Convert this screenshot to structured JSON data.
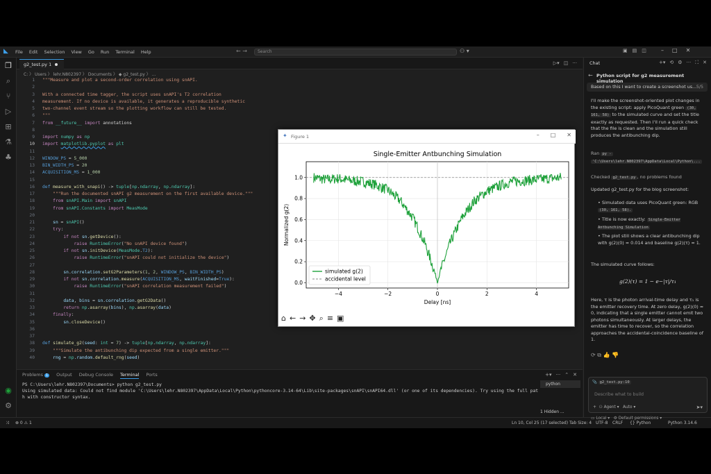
{
  "titlebar": {
    "menus": [
      "File",
      "Edit",
      "Selection",
      "View",
      "Go",
      "Run",
      "Terminal",
      "Help"
    ],
    "search_placeholder": "Search"
  },
  "editor": {
    "tab_label": "g2_test.py 1",
    "breadcrumb": "C: 〉 Users 〉 lehr.N802397 〉 Documents 〉 ◆ g2_test.py 〉 ...",
    "lines": [
      {
        "n": "1",
        "html": "<span class='s'>\"\"\"Measure and plot a second-order correlation using snAPI.</span>"
      },
      {
        "n": "2",
        "html": ""
      },
      {
        "n": "3",
        "html": "<span class='s'>With a connected time tagger, the script uses snAPI's T2 correlation</span>"
      },
      {
        "n": "4",
        "html": "<span class='s'>measurement. If no device is available, it generates a reproducible synthetic</span>"
      },
      {
        "n": "5",
        "html": "<span class='s'>two-channel event stream so the plotting workflow can still be tested.</span>"
      },
      {
        "n": "6",
        "html": "<span class='s'>\"\"\"</span>"
      },
      {
        "n": "7",
        "html": "<span class='k'>from</span> <span class='t'>__future__</span> <span class='k'>import</span> annotations"
      },
      {
        "n": "8",
        "html": ""
      },
      {
        "n": "9",
        "html": "<span class='k'>import</span> <span class='t'>numpy</span> <span class='k'>as</span> <span class='t'>np</span>"
      },
      {
        "n": "10",
        "html": "<span class='k'>import</span> <span class='t' style='text-decoration:underline wavy #3c9ee8'>matplotlib.pyplot</span> <span class='k'>as</span> <span class='t'>plt</span>"
      },
      {
        "n": "11",
        "html": ""
      },
      {
        "n": "12",
        "html": "<span class='d'>WINDOW_PS</span> = <span class='n'>5_000</span>"
      },
      {
        "n": "13",
        "html": "<span class='d'>BIN_WIDTH_PS</span> = <span class='n'>20</span>"
      },
      {
        "n": "14",
        "html": "<span class='d'>ACQUISITION_MS</span> = <span class='n'>1_000</span>"
      },
      {
        "n": "15",
        "html": ""
      },
      {
        "n": "16",
        "html": "<span class='d'>def</span> <span class='f'>measure_with_snapi</span>() -> <span class='t'>tuple</span>[<span class='t'>np</span>.<span class='t'>ndarray</span>, <span class='t'>np</span>.<span class='t'>ndarray</span>]:"
      },
      {
        "n": "17",
        "html": "    <span class='s'>\"\"\"Run the documented snAPI g2 measurement on the first available device.\"\"\"</span>"
      },
      {
        "n": "18",
        "html": "    <span class='k'>from</span> <span class='t'>snAPI.Main</span> <span class='k'>import</span> <span class='t'>snAPI</span>"
      },
      {
        "n": "19",
        "html": "    <span class='k'>from</span> <span class='t'>snAPI.Constants</span> <span class='k'>import</span> <span class='t'>MeasMode</span>"
      },
      {
        "n": "20",
        "html": ""
      },
      {
        "n": "21",
        "html": "    <span class='v'>sn</span> = <span class='t'>snAPI</span>()"
      },
      {
        "n": "22",
        "html": "    <span class='k'>try</span>:"
      },
      {
        "n": "23",
        "html": "        <span class='k'>if not</span> <span class='v'>sn</span>.<span class='f'>getDevice</span>():"
      },
      {
        "n": "24",
        "html": "            <span class='k'>raise</span> <span class='t'>RuntimeError</span>(<span class='s'>\"No snAPI device found\"</span>)"
      },
      {
        "n": "25",
        "html": "        <span class='k'>if not</span> <span class='v'>sn</span>.<span class='f'>initDevice</span>(<span class='t'>MeasMode</span>.<span class='d'>T2</span>):"
      },
      {
        "n": "26",
        "html": "            <span class='k'>raise</span> <span class='t'>RuntimeError</span>(<span class='s'>\"snAPI could not initialize the device\"</span>)"
      },
      {
        "n": "27",
        "html": ""
      },
      {
        "n": "28",
        "html": "        <span class='v'>sn</span>.<span class='v'>correlation</span>.<span class='f'>setG2Parameters</span>(<span class='n'>1</span>, <span class='n'>2</span>, <span class='d'>WINDOW_PS</span>, <span class='d'>BIN_WIDTH_PS</span>)"
      },
      {
        "n": "29",
        "html": "        <span class='k'>if not</span> <span class='v'>sn</span>.<span class='v'>correlation</span>.<span class='f'>measure</span>(<span class='d'>ACQUISITION_MS</span>, <span class='v'>waitFinished</span>=<span class='d'>True</span>):"
      },
      {
        "n": "30",
        "html": "            <span class='k'>raise</span> <span class='t'>RuntimeError</span>(<span class='s'>\"snAPI correlation measurement failed\"</span>)"
      },
      {
        "n": "31",
        "html": ""
      },
      {
        "n": "32",
        "html": "        <span class='v'>data</span>, <span class='v'>bins</span> = <span class='v'>sn</span>.<span class='v'>correlation</span>.<span class='f'>getG2Data</span>()"
      },
      {
        "n": "33",
        "html": "        <span class='k'>return</span> <span class='t'>np</span>.<span class='f'>asarray</span>(<span class='v'>bins</span>), <span class='t'>np</span>.<span class='f'>asarray</span>(<span class='v'>data</span>)"
      },
      {
        "n": "34",
        "html": "    <span class='k'>finally</span>:"
      },
      {
        "n": "35",
        "html": "        <span class='v'>sn</span>.<span class='f'>closeDevice</span>()"
      },
      {
        "n": "36",
        "html": ""
      },
      {
        "n": "37",
        "html": ""
      },
      {
        "n": "38",
        "html": "<span class='d'>def</span> <span class='f'>simulate_g2</span>(<span class='v'>seed</span>: <span class='t'>int</span> = <span class='n'>7</span>) -> <span class='t'>tuple</span>[<span class='t'>np</span>.<span class='t'>ndarray</span>, <span class='t'>np</span>.<span class='t'>ndarray</span>]:"
      },
      {
        "n": "39",
        "html": "    <span class='s'>\"\"\"Simulate the antibunching dip expected from a single emitter.\"\"\"</span>"
      },
      {
        "n": "40",
        "html": "    <span class='v'>rng</span> = <span class='t'>np</span>.<span class='v'>random</span>.<span class='f'>default_rng</span>(<span class='v'>seed</span>)"
      }
    ]
  },
  "panel": {
    "tabs": [
      "Problems",
      "Output",
      "Debug Console",
      "Terminal",
      "Ports"
    ],
    "problems_count": "1",
    "terminal_name": "python",
    "hidden": "1 Hidden ...",
    "terminal_lines": [
      "PS C:\\Users\\lehr.N802397\\Documents> python g2_test.py",
      "Using simulated data: Could not find module 'C:\\Users\\lehr.N802397\\AppData\\Local\\Python\\pythoncore-3.14-64\\Lib\\site-packages\\snAPI\\snAPI64.dll' (or one of its dependencies). Try using the full pat",
      "h with constructor syntax."
    ]
  },
  "status": {
    "errors": "⊗ 0 ⚠ 1",
    "position": "Ln 10, Col 25 (17 selected)",
    "tab": "Tab Size: 4",
    "enc": "UTF-8",
    "eol": "CRLF",
    "lang": "{} Python",
    "ver": "Python 3.14.6"
  },
  "chat": {
    "header": "Chat",
    "title": "Python script for g2 measurement simulation",
    "query": "Based on this I want to create a screenshot us...",
    "query_count": "5/5",
    "p1a": "I'll make the screenshot-oriented plot changes in the existing script: apply PicoQuant green",
    "p1chip": "(30, 161, 58)",
    "p1b": "to the simulated curve and set the title exactly as requested. Then I'll run a quick check that the file is clean and the simulation still produces the antibunching dip.",
    "ran": "Ran",
    "ran_chip": "py -",
    "ran_path": "'C:\\Users\\lehr.N802397\\AppData\\Local\\Python\\...",
    "checked": "Checked",
    "checked_chip": "g2_test.py",
    "checked_tail": ", no problems found",
    "updated": "Updated g2_test.py for the blog screenshot:",
    "b1": "Simulated data uses PicoQuant green: RGB",
    "b1chip": "(30, 161, 58).",
    "b2": "Title is now exactly:",
    "b2chip": "Single-Emitter Antbunching Simulation",
    "b3": "The plot still shows a clear antibunching dip with g(2)(0) ≈ 0.014 and baseline g(2)(τ) ≈ 1.",
    "follows": "The simulated curve follows:",
    "formula": "g(2)(τ) = 1 − e−|τ|/τ₁",
    "p2": "Here, τ is the photon arrival-time delay and τ₁ is the emitter recovery time. At zero delay, g(2)(0) ≈ 0, indicating that a single emitter cannot emit two photons simultaneously. At larger delays, the emitter has time to recover, so the correlation approaches the accidental-coincidence baseline of 1.",
    "context_chip": "g2_test.py:10",
    "input_placeholder": "Describe what to build",
    "agent": "Agent",
    "auto": "Auto",
    "local": "Local",
    "perm": "Default permissions"
  },
  "figure": {
    "window_title": "Figure 1"
  },
  "chart_data": {
    "type": "line",
    "title": "Single-Emitter Antbunching Simulation",
    "xlabel": "Delay [ns]",
    "ylabel": "Normalized g(2)",
    "xlim": [
      -5.3,
      5.3
    ],
    "ylim": [
      -0.05,
      1.15
    ],
    "xticks": [
      -4,
      -2,
      0,
      2,
      4
    ],
    "yticks": [
      0.0,
      0.2,
      0.4,
      0.6,
      0.8,
      1.0
    ],
    "x": [
      -5,
      -4.5,
      -4,
      -3.5,
      -3,
      -2.5,
      -2,
      -1.5,
      -1,
      -0.75,
      -0.5,
      -0.25,
      -0.1,
      0,
      0.1,
      0.25,
      0.5,
      0.75,
      1,
      1.5,
      2,
      2.5,
      3,
      3.5,
      4,
      4.5,
      5
    ],
    "y": [
      1.0,
      0.98,
      0.99,
      0.97,
      0.96,
      0.93,
      0.88,
      0.78,
      0.62,
      0.5,
      0.37,
      0.2,
      0.09,
      0.01,
      0.09,
      0.2,
      0.37,
      0.5,
      0.62,
      0.78,
      0.87,
      0.92,
      0.96,
      0.97,
      0.98,
      0.99,
      1.0
    ],
    "series": [
      {
        "name": "simulated g(2)",
        "color": "#1ea13a"
      },
      {
        "name": "accidental level",
        "color": "#888888",
        "style": "dashed",
        "value": 1.0
      }
    ],
    "grid": true,
    "legend": "lower-left"
  }
}
